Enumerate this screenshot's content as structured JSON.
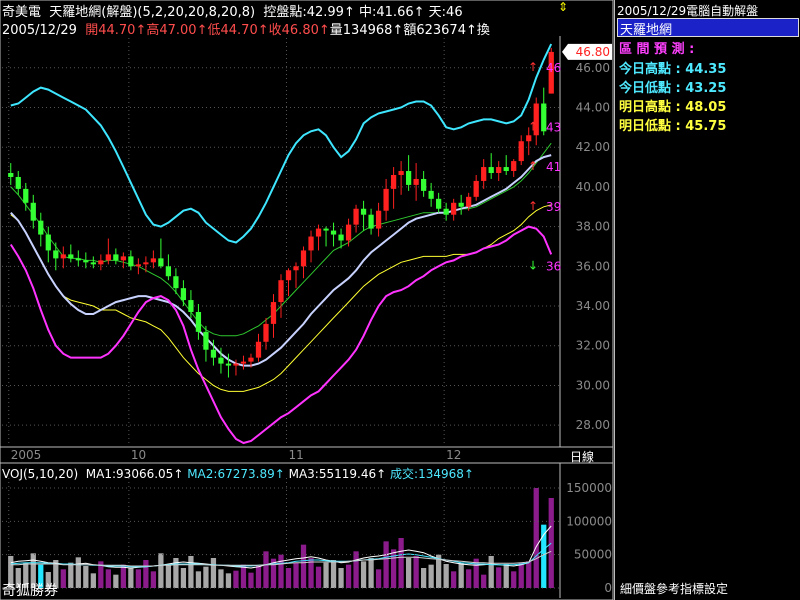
{
  "header": {
    "stock_name": "奇美電",
    "indicator": "天羅地網(解盤)(5,2,20,20,8,20,8)",
    "pivot_label": "控盤點:",
    "pivot_value": "42.99",
    "mid_label": "中:",
    "mid_value": "41.66",
    "sky_label": "天:",
    "sky_value": "46"
  },
  "quote": {
    "date": "2005/12/29",
    "open_label": "開",
    "open": "44.70",
    "high_label": "高",
    "high": "47.00",
    "low_label": "低",
    "low": "44.70",
    "close_label": "收",
    "close": "46.80",
    "volume_label": "量",
    "volume": "134968",
    "amount_label": "額",
    "amount": "623674",
    "turnover_label": "換"
  },
  "side_panel": {
    "date_text": "2005/12/29",
    "title_text": "電腦自動解盤",
    "selected_item": "天羅地網",
    "forecast_label": "區 間 預 測 :",
    "today_high_label": "今日高點 :",
    "today_high": "44.35",
    "today_low_label": "今日低點 :",
    "today_low": "43.25",
    "tomorrow_high_label": "明日高點 :",
    "tomorrow_high": "48.05",
    "tomorrow_low_label": "明日低點 :",
    "tomorrow_low": "45.75"
  },
  "volume_header": {
    "voj": "VOJ(5,10,20)",
    "ma1_label": "MA1:",
    "ma1": "93066.05",
    "ma2_label": "MA2:",
    "ma2": "67273.89",
    "ma3_label": "MA3:",
    "ma3": "55119.46",
    "trade_label": "成交:",
    "trade": "134968"
  },
  "footer": {
    "broker": "奇狐勝券",
    "status": "細價盤參考指標設定",
    "period": "日線"
  },
  "colors": {
    "up": "#ff2020",
    "down": "#33ff33",
    "upper_band": "#3ee6ff",
    "lower_band": "#ff33ff",
    "middle_line": "#c8d2ff",
    "green_ma": "#2ec82e",
    "yellow_ma": "#ffff33",
    "vol_purple": "#8c1c8c",
    "vol_gray": "#a8a8a8",
    "vol_cyan": "#22e6ff"
  },
  "chart_data": {
    "type": "candlestick",
    "ylim": [
      27,
      47.5
    ],
    "y_ticks": [
      "28.00",
      "30.00",
      "32.00",
      "34.00",
      "36.00",
      "38.00",
      "40.00",
      "42.00",
      "44.00",
      "46.00"
    ],
    "x_labels": [
      "2005",
      "10",
      "11",
      "12"
    ],
    "last_price_tag": "46.80",
    "right_markers": [
      "46",
      "43",
      "41",
      "39",
      "36"
    ],
    "candles": [
      [
        40.7,
        41.2,
        40.1,
        40.5
      ],
      [
        40.5,
        40.8,
        39.6,
        39.9
      ],
      [
        39.9,
        40.2,
        38.8,
        39.2
      ],
      [
        39.2,
        39.6,
        37.9,
        38.3
      ],
      [
        38.3,
        38.7,
        37.0,
        37.6
      ],
      [
        37.6,
        38.0,
        36.2,
        36.8
      ],
      [
        36.8,
        37.2,
        35.8,
        36.4
      ],
      [
        36.4,
        37.0,
        35.9,
        36.6
      ],
      [
        36.6,
        37.1,
        36.2,
        36.4
      ],
      [
        36.4,
        36.8,
        36.0,
        36.3
      ],
      [
        36.3,
        36.7,
        35.9,
        36.2
      ],
      [
        36.2,
        36.5,
        35.9,
        36.1
      ],
      [
        36.1,
        36.6,
        35.8,
        36.3
      ],
      [
        36.3,
        37.4,
        36.1,
        36.6
      ],
      [
        36.6,
        36.9,
        36.1,
        36.3
      ],
      [
        36.3,
        36.7,
        35.9,
        36.5
      ],
      [
        36.5,
        36.8,
        35.8,
        36.0
      ],
      [
        36.0,
        36.4,
        35.6,
        36.1
      ],
      [
        36.1,
        36.5,
        35.7,
        36.2
      ],
      [
        36.2,
        36.8,
        35.9,
        36.4
      ],
      [
        36.4,
        37.4,
        35.9,
        36.0
      ],
      [
        36.0,
        36.6,
        35.3,
        35.5
      ],
      [
        35.5,
        35.9,
        34.6,
        34.9
      ],
      [
        34.9,
        35.3,
        34.0,
        34.3
      ],
      [
        34.3,
        34.8,
        33.4,
        33.7
      ],
      [
        33.7,
        34.1,
        32.3,
        32.7
      ],
      [
        32.7,
        33.0,
        31.2,
        31.8
      ],
      [
        31.8,
        32.3,
        31.0,
        31.4
      ],
      [
        31.4,
        31.9,
        30.6,
        31.1
      ],
      [
        31.1,
        31.6,
        30.4,
        31.0
      ],
      [
        31.0,
        31.3,
        30.5,
        31.1
      ],
      [
        31.1,
        31.5,
        30.8,
        31.2
      ],
      [
        31.2,
        31.6,
        30.9,
        31.4
      ],
      [
        31.4,
        32.6,
        31.2,
        32.2
      ],
      [
        32.2,
        33.4,
        31.8,
        33.1
      ],
      [
        33.1,
        34.6,
        32.4,
        34.2
      ],
      [
        34.2,
        35.6,
        33.4,
        35.3
      ],
      [
        35.3,
        35.9,
        34.5,
        35.8
      ],
      [
        35.8,
        36.2,
        34.9,
        36.0
      ],
      [
        36.0,
        37.0,
        35.4,
        36.8
      ],
      [
        36.8,
        37.8,
        36.2,
        37.5
      ],
      [
        37.5,
        38.1,
        36.8,
        37.9
      ],
      [
        37.9,
        38.0,
        37.0,
        37.8
      ],
      [
        37.8,
        38.2,
        37.0,
        37.6
      ],
      [
        37.6,
        37.9,
        36.9,
        37.3
      ],
      [
        37.3,
        38.4,
        37.0,
        38.1
      ],
      [
        38.1,
        39.1,
        37.7,
        38.9
      ],
      [
        38.9,
        39.3,
        37.8,
        38.6
      ],
      [
        38.6,
        38.9,
        37.6,
        37.9
      ],
      [
        37.9,
        39.2,
        37.5,
        38.8
      ],
      [
        38.8,
        40.4,
        38.3,
        39.9
      ],
      [
        39.9,
        41.0,
        38.9,
        40.6
      ],
      [
        40.6,
        41.3,
        39.6,
        40.8
      ],
      [
        40.8,
        41.6,
        39.8,
        40.1
      ],
      [
        40.1,
        41.2,
        39.3,
        40.4
      ],
      [
        40.4,
        40.8,
        39.5,
        39.8
      ],
      [
        39.8,
        40.2,
        39.0,
        39.4
      ],
      [
        39.4,
        39.7,
        38.7,
        38.9
      ],
      [
        38.9,
        39.2,
        38.3,
        38.6
      ],
      [
        38.6,
        39.4,
        38.3,
        39.2
      ],
      [
        39.2,
        39.6,
        38.6,
        39.0
      ],
      [
        39.0,
        39.7,
        38.8,
        39.5
      ],
      [
        39.5,
        40.6,
        39.3,
        40.3
      ],
      [
        40.3,
        41.4,
        39.9,
        41.0
      ],
      [
        41.0,
        41.7,
        40.4,
        40.7
      ],
      [
        40.7,
        41.3,
        40.3,
        41.0
      ],
      [
        41.0,
        41.6,
        40.6,
        40.8
      ],
      [
        40.8,
        41.4,
        40.5,
        41.3
      ],
      [
        41.3,
        42.6,
        41.1,
        42.3
      ],
      [
        42.3,
        43.0,
        41.6,
        42.6
      ],
      [
        42.6,
        44.5,
        42.1,
        44.2
      ],
      [
        44.2,
        45.0,
        42.6,
        42.8
      ],
      [
        44.7,
        47.0,
        44.7,
        46.8
      ]
    ],
    "series": [
      {
        "values": [
          44.1,
          44.2,
          44.5,
          44.8,
          45.0,
          44.9,
          44.7,
          44.5,
          44.3,
          44.1,
          43.9,
          43.5,
          43.1,
          42.5,
          41.8,
          41.0,
          40.2,
          39.4,
          38.6,
          38.1,
          38.0,
          38.2,
          38.5,
          38.8,
          38.9,
          38.7,
          38.2,
          37.9,
          37.6,
          37.3,
          37.2,
          37.5,
          37.9,
          38.5,
          39.2,
          40.0,
          40.8,
          41.6,
          42.2,
          42.6,
          42.8,
          42.9,
          42.6,
          42.0,
          41.5,
          41.8,
          42.4,
          43.2,
          43.5,
          43.7,
          43.8,
          43.9,
          44.0,
          44.2,
          44.3,
          44.3,
          44.1,
          43.6,
          43.0,
          42.9,
          43.0,
          43.2,
          43.3,
          43.4,
          43.4,
          43.3,
          43.2,
          43.3,
          43.6,
          44.4,
          45.5,
          46.4,
          47.2
        ]
      },
      {
        "values": [
          40.0,
          39.6,
          39.1,
          38.6,
          38.1,
          37.5,
          37.0,
          36.5,
          36.4,
          36.4,
          36.3,
          36.3,
          36.2,
          36.3,
          36.3,
          36.2,
          36.1,
          36.0,
          35.8,
          35.6,
          35.4,
          35.1,
          34.7,
          34.2,
          33.7,
          33.2,
          32.8,
          32.6,
          32.5,
          32.5,
          32.5,
          32.6,
          32.8,
          33.0,
          33.3,
          33.6,
          34.0,
          34.4,
          34.8,
          35.2,
          35.6,
          36.0,
          36.4,
          36.8,
          37.0,
          37.2,
          37.5,
          37.8,
          38.0,
          38.1,
          38.2,
          38.3,
          38.4,
          38.5,
          38.6,
          38.7,
          38.7,
          38.7,
          38.7,
          38.8,
          38.9,
          38.9,
          39.0,
          39.2,
          39.4,
          39.6,
          39.8,
          40.0,
          40.3,
          40.7,
          41.2,
          41.7,
          42.2
        ]
      },
      {
        "values": [
          38.6,
          38.3,
          37.7,
          37.0,
          36.3,
          35.6,
          35.0,
          34.5,
          34.3,
          34.2,
          34.1,
          34.0,
          33.8,
          33.8,
          33.8,
          33.6,
          33.4,
          33.3,
          33.2,
          33.0,
          32.8,
          32.4,
          31.9,
          31.4,
          31.0,
          30.6,
          30.3,
          30.0,
          29.8,
          29.7,
          29.7,
          29.7,
          29.8,
          29.9,
          30.1,
          30.3,
          30.6,
          31.0,
          31.4,
          31.8,
          32.2,
          32.6,
          33.0,
          33.4,
          33.8,
          34.2,
          34.6,
          35.0,
          35.3,
          35.6,
          35.8,
          36.0,
          36.2,
          36.3,
          36.4,
          36.5,
          36.5,
          36.5,
          36.5,
          36.6,
          36.6,
          36.6,
          36.7,
          36.9,
          37.1,
          37.4,
          37.6,
          37.8,
          38.1,
          38.5,
          38.8,
          39.0,
          39.1
        ]
      },
      {
        "values": [
          38.7,
          38.3,
          37.7,
          37.0,
          36.3,
          35.6,
          35.0,
          34.5,
          34.1,
          33.8,
          33.6,
          33.6,
          33.8,
          34.0,
          34.2,
          34.3,
          34.4,
          34.5,
          34.5,
          34.4,
          34.3,
          34.2,
          34.0,
          33.7,
          33.3,
          32.8,
          32.4,
          32.0,
          31.6,
          31.3,
          31.1,
          31.0,
          31.0,
          31.1,
          31.3,
          31.6,
          31.9,
          32.3,
          32.7,
          33.1,
          33.6,
          34.0,
          34.4,
          34.8,
          35.1,
          35.4,
          35.8,
          36.3,
          36.7,
          37.0,
          37.3,
          37.6,
          37.9,
          38.2,
          38.4,
          38.5,
          38.6,
          38.7,
          38.7,
          38.8,
          38.9,
          39.0,
          39.1,
          39.3,
          39.5,
          39.7,
          39.9,
          40.2,
          40.5,
          40.9,
          41.3,
          41.5,
          41.6
        ]
      },
      {
        "values": [
          37.1,
          36.5,
          35.8,
          34.9,
          33.8,
          32.8,
          32.0,
          31.6,
          31.4,
          31.4,
          31.4,
          31.4,
          31.4,
          31.6,
          32.0,
          32.5,
          33.1,
          33.7,
          34.2,
          34.4,
          34.5,
          34.3,
          33.8,
          33.0,
          31.8,
          30.8,
          30.0,
          29.2,
          28.4,
          27.8,
          27.3,
          27.1,
          27.2,
          27.5,
          27.8,
          28.1,
          28.4,
          28.6,
          28.9,
          29.2,
          29.5,
          29.7,
          30.1,
          30.5,
          30.9,
          31.3,
          31.8,
          32.5,
          33.3,
          34.0,
          34.5,
          34.7,
          34.8,
          35.0,
          35.3,
          35.5,
          35.8,
          36.0,
          36.2,
          36.3,
          36.5,
          36.6,
          36.7,
          36.9,
          37.0,
          37.1,
          37.3,
          37.6,
          37.8,
          38.0,
          37.9,
          37.5,
          36.6
        ]
      }
    ],
    "volume": {
      "ylim": [
        0,
        165000
      ],
      "y_ticks": [
        "0",
        "50000",
        "100000",
        "150000"
      ],
      "values": [
        48000,
        30000,
        38000,
        52000,
        35000,
        24000,
        42000,
        28000,
        38000,
        46000,
        33000,
        22000,
        40000,
        28000,
        20000,
        35000,
        30000,
        28000,
        42000,
        25000,
        52000,
        36000,
        45000,
        30000,
        48000,
        25000,
        32000,
        45000,
        28000,
        22000,
        26000,
        35000,
        23000,
        33000,
        55000,
        44000,
        50000,
        30000,
        38000,
        65000,
        45000,
        32000,
        38000,
        42000,
        30000,
        35000,
        55000,
        40000,
        45000,
        28000,
        70000,
        58000,
        75000,
        45000,
        48000,
        30000,
        35000,
        50000,
        36000,
        25000,
        38000,
        28000,
        44000,
        20000,
        48000,
        31000,
        36000,
        25000,
        38000,
        40000,
        150000,
        95000,
        135000
      ],
      "ma_series": [
        {
          "values": [
            38000,
            40000,
            41000,
            42000,
            40000,
            38000,
            37000,
            36000,
            35000,
            36000,
            37000,
            35000,
            34000,
            32000,
            31000,
            31000,
            30000,
            31000,
            32000,
            33000,
            34000,
            36000,
            38000,
            39000,
            38000,
            37000,
            36000,
            35000,
            34000,
            33000,
            32000,
            31000,
            30000,
            32000,
            35000,
            38000,
            40000,
            42000,
            44000,
            45000,
            47000,
            45000,
            42000,
            40000,
            38000,
            39000,
            42000,
            45000,
            47000,
            48000,
            50000,
            53000,
            55000,
            57000,
            55000,
            53000,
            48000,
            44000,
            40000,
            38000,
            36000,
            35000,
            34000,
            35000,
            36000,
            35000,
            34000,
            33000,
            35000,
            38000,
            62000,
            80000,
            93066
          ]
        },
        {
          "values": [
            36000,
            37000,
            38000,
            38000,
            38000,
            37000,
            36000,
            36000,
            36000,
            35000,
            35000,
            34000,
            34000,
            33000,
            33000,
            33000,
            32000,
            32000,
            32000,
            33000,
            34000,
            35000,
            36000,
            36000,
            36000,
            36000,
            35000,
            35000,
            34000,
            34000,
            33000,
            33000,
            33000,
            34000,
            35000,
            36000,
            37000,
            38000,
            40000,
            41000,
            42000,
            42000,
            41000,
            40000,
            40000,
            40000,
            41000,
            42000,
            43000,
            44000,
            46000,
            48000,
            50000,
            51000,
            50000,
            48000,
            46000,
            44000,
            42000,
            40000,
            38000,
            37000,
            36000,
            36000,
            35000,
            35000,
            35000,
            35000,
            36000,
            38000,
            48000,
            58000,
            67273
          ]
        },
        {
          "values": [
            35000,
            35000,
            36000,
            36000,
            36000,
            36000,
            36000,
            35000,
            35000,
            35000,
            35000,
            35000,
            34000,
            34000,
            34000,
            34000,
            33000,
            33000,
            33000,
            33000,
            34000,
            34000,
            35000,
            35000,
            35000,
            35000,
            35000,
            34000,
            34000,
            34000,
            34000,
            34000,
            34000,
            34000,
            35000,
            35000,
            36000,
            37000,
            38000,
            38000,
            39000,
            39000,
            39000,
            39000,
            39000,
            40000,
            41000,
            42000,
            42000,
            43000,
            44000,
            45000,
            46000,
            46000,
            46000,
            45000,
            44000,
            43000,
            42000,
            41000,
            40000,
            39000,
            38000,
            38000,
            37000,
            37000,
            37000,
            37000,
            38000,
            39000,
            44000,
            50000,
            55119
          ]
        }
      ]
    }
  }
}
